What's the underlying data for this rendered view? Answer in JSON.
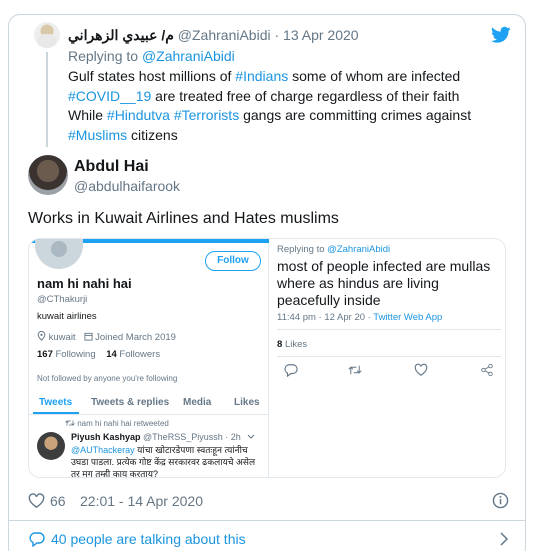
{
  "parent_tweet": {
    "display_name": "م/ عبيدي الزهراني",
    "handle": "@ZahraniAbidi",
    "separator": "·",
    "date": "13 Apr 2020",
    "replying_label": "Replying to",
    "replying_to": "@ZahraniAbidi",
    "body": {
      "t1": "Gulf states host millions of ",
      "h1": "#Indians",
      "t2": " some of whom are infected ",
      "h2": "#COVID__19",
      "t3": " are treated free of charge regardless of their faith While ",
      "h3": "#Hindutva",
      "t4": " ",
      "h4": "#Terrorists",
      "t5": " gangs are committing crimes against ",
      "h5": "#Muslims",
      "t6": " citizens"
    }
  },
  "main_tweet": {
    "display_name": "Abdul Hai",
    "handle": "@abdulhaifarook",
    "text": "Works in Kuwait Airlines and Hates muslims",
    "like_count": "66",
    "timestamp": "22:01 - 14 Apr 2020"
  },
  "screenshot_left": {
    "follow_label": "Follow",
    "name": "nam hi nahi hai",
    "handle": "@CThakurji",
    "bio": "kuwait airlines",
    "location": "kuwait",
    "joined": "Joined March 2019",
    "following_count": "167",
    "following_label": "Following",
    "followers_count": "14",
    "followers_label": "Followers",
    "not_followed": "Not followed by anyone you're following",
    "tabs": [
      "Tweets",
      "Tweets & replies",
      "Media",
      "Likes"
    ],
    "retweeted_label": "nam hi nahi hai retweeted",
    "rt_name": "Piyush Kashyap",
    "rt_handle": "@TheRSS_Piyussh",
    "rt_time": "· 2h",
    "rt_mention": "@AUThackeray",
    "rt_text": " यांचा खोटारडेपणा स्वतःहून त्यांनीच उघडा पाडला. प्रत्येक गोष्ट केंद्र सरकारवर ढकलायचे असेल तर मग तुम्ही काय करताय?"
  },
  "screenshot_right": {
    "replying_label": "Replying to",
    "replying_to": "@ZahraniAbidi",
    "text": "most of people infected are mullas where as hindus are living peacefully inside",
    "meta": "11:44 pm · 12 Apr 20 · ",
    "source": "Twitter Web App",
    "likes_count": "8",
    "likes_label": "Likes"
  },
  "footer": {
    "talking_text": "40 people are talking about this"
  },
  "colors": {
    "link": "#1b95e0",
    "twitter_blue": "#1da1f2",
    "muted": "#657786",
    "border": "#ccd6dd"
  },
  "icons": [
    "twitter-bird-icon",
    "heart-icon",
    "info-icon",
    "speech-bubble-icon",
    "chevron-right-icon",
    "location-icon",
    "calendar-icon",
    "retweet-icon",
    "reply-icon",
    "share-icon",
    "caret-down-icon"
  ]
}
